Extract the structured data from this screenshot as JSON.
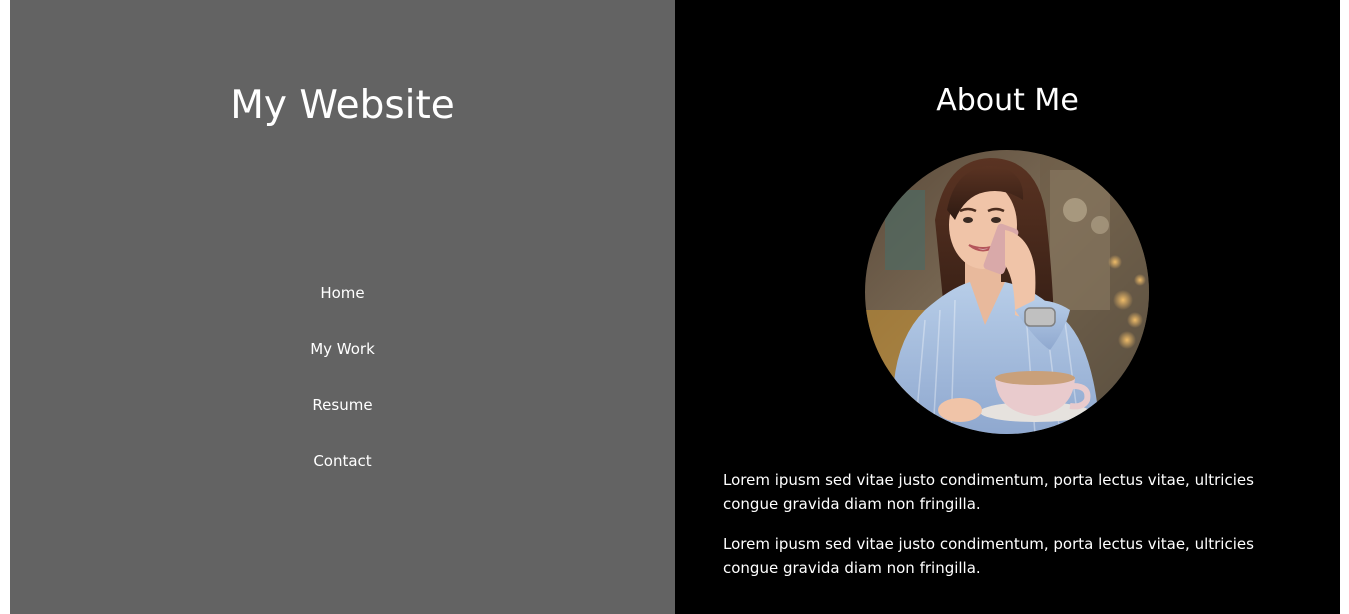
{
  "site": {
    "title": "My Website"
  },
  "nav": {
    "items": [
      {
        "label": "Home"
      },
      {
        "label": "My Work"
      },
      {
        "label": "Resume"
      },
      {
        "label": "Contact"
      }
    ]
  },
  "about": {
    "title": "About Me",
    "paragraphs": [
      "Lorem ipusm sed vitae justo condimentum, porta lectus vitae, ultricies congue gravida diam non fringilla.",
      "Lorem ipusm sed vitae justo condimentum, porta lectus vitae, ultricies congue gravida diam non fringilla."
    ]
  },
  "colors": {
    "sidebar_bg": "#636363",
    "content_bg": "#000000",
    "text": "#ffffff"
  }
}
